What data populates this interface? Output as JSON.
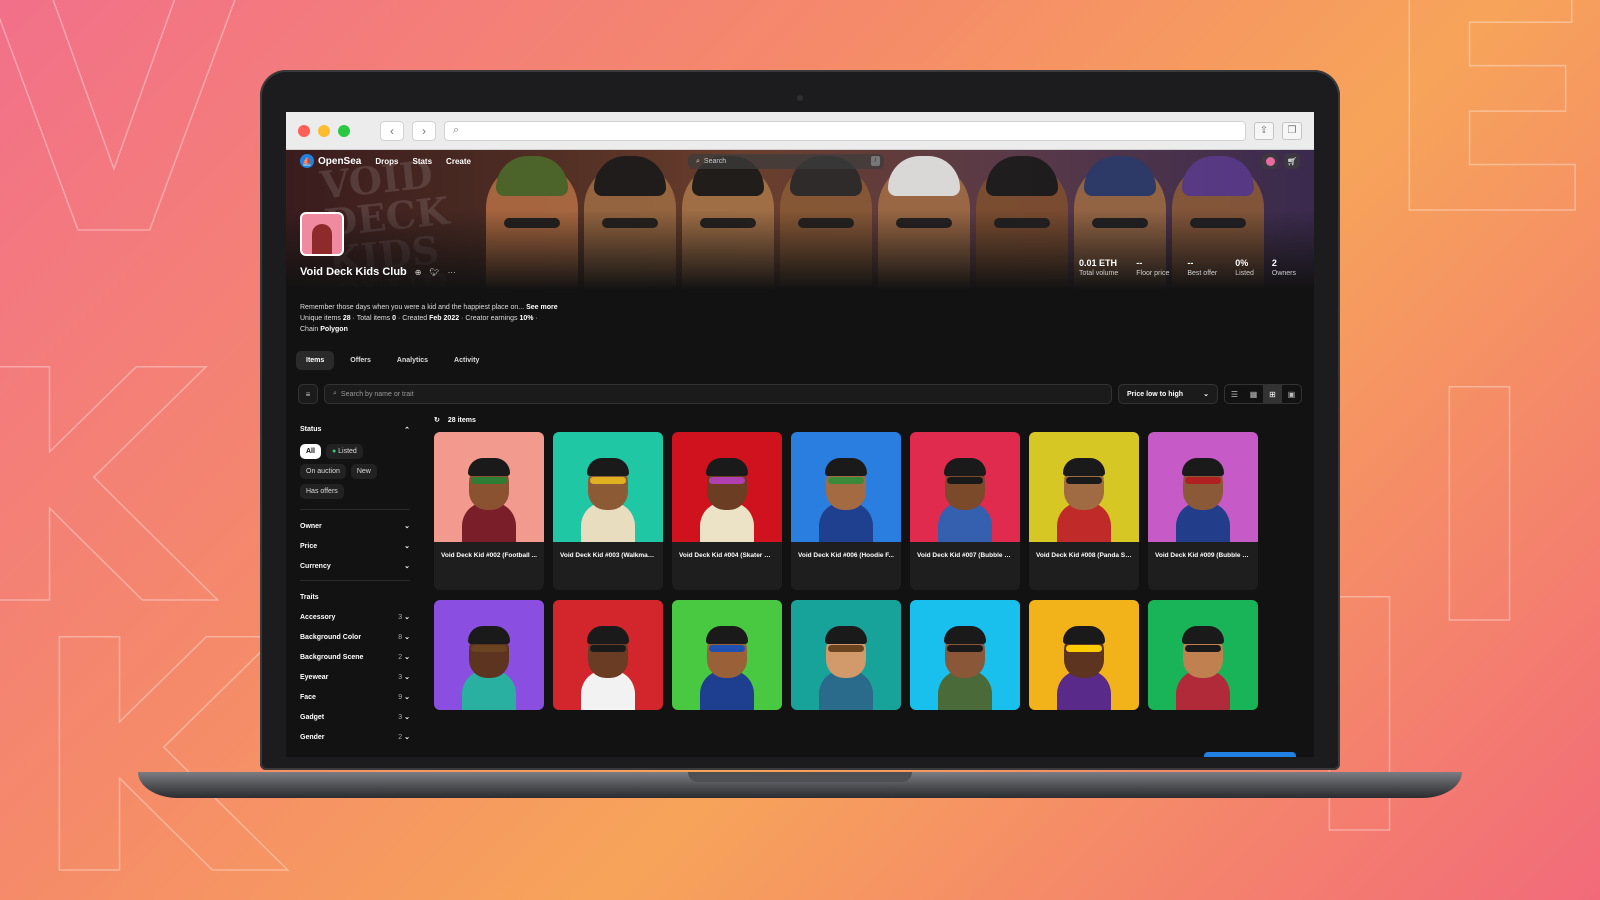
{
  "topnav": {
    "brand": "OpenSea",
    "links": [
      "Drops",
      "Stats",
      "Create"
    ],
    "search_placeholder": "Search",
    "search_shortcut": "/"
  },
  "collection": {
    "title": "Void Deck Kids Club",
    "banner_text": "VOID DECK KIDS CLUB",
    "stats": [
      {
        "value": "0.01 ETH",
        "label": "Total volume"
      },
      {
        "value": "--",
        "label": "Floor price"
      },
      {
        "value": "--",
        "label": "Best offer"
      },
      {
        "value": "0%",
        "label": "Listed"
      },
      {
        "value": "2",
        "label": "Owners"
      }
    ],
    "description": "Remember those days when you were a kid and the happiest place on...",
    "see_more": "See more",
    "meta": {
      "unique_items_label": "Unique items",
      "unique_items": "28",
      "total_items_label": "Total items",
      "total_items": "0",
      "created_label": "Created",
      "created": "Feb 2022",
      "earnings_label": "Creator earnings",
      "earnings": "10%",
      "chain_label": "Chain",
      "chain": "Polygon"
    }
  },
  "tabs": [
    "Items",
    "Offers",
    "Analytics",
    "Activity"
  ],
  "toolbar": {
    "search_placeholder": "Search by name or trait",
    "sort": "Price low to high"
  },
  "sidebar": {
    "status_label": "Status",
    "status_chips": [
      "All",
      "Listed",
      "On auction",
      "New",
      "Has offers"
    ],
    "filters": [
      "Owner",
      "Price",
      "Currency"
    ],
    "traits_label": "Traits",
    "traits": [
      {
        "name": "Accessory",
        "count": "3"
      },
      {
        "name": "Background Color",
        "count": "8"
      },
      {
        "name": "Background Scene",
        "count": "2"
      },
      {
        "name": "Eyewear",
        "count": "3"
      },
      {
        "name": "Face",
        "count": "9"
      },
      {
        "name": "Gadget",
        "count": "3"
      },
      {
        "name": "Gender",
        "count": "2"
      }
    ]
  },
  "results": {
    "count_text": "28 items"
  },
  "items_row1": [
    {
      "name": "Void Deck Kid #002 (Football ...",
      "bg": "#f39a8e",
      "shirt": "#7a1f2a",
      "skin": "#8a5230",
      "glass": "#2f7d35"
    },
    {
      "name": "Void Deck Kid #003 (Walkman ...",
      "bg": "#1fc7a5",
      "shirt": "#e9ddc0",
      "skin": "#8d5a36",
      "glass": "#e0b020"
    },
    {
      "name": "Void Deck Kid #004 (Skater Kid)",
      "bg": "#d0121e",
      "shirt": "#ece2c6",
      "skin": "#6b3d22",
      "glass": "#b040b0"
    },
    {
      "name": "Void Deck Kid #006 (Hoodie F...",
      "bg": "#2a7ee0",
      "shirt": "#1f3f8f",
      "skin": "#a46a42",
      "glass": "#3a8a3a"
    },
    {
      "name": "Void Deck Kid #007 (Bubble G...",
      "bg": "#e02a4e",
      "shirt": "#3560b0",
      "skin": "#7a4a2a",
      "glass": "#1a1a1a"
    },
    {
      "name": "Void Deck Kid #008 (Panda Sk...",
      "bg": "#d7c724",
      "shirt": "#c02a28",
      "skin": "#a06a42",
      "glass": "#1a1a1a"
    },
    {
      "name": "Void Deck Kid #009 (Bubble G...",
      "bg": "#c65ac6",
      "shirt": "#223e8a",
      "skin": "#8a5a38",
      "glass": "#b02020"
    }
  ],
  "items_row2": [
    {
      "name": "",
      "bg": "#8a4ee0",
      "shirt": "#2ab0a0",
      "skin": "#5c3420",
      "glass": "#6a4420"
    },
    {
      "name": "",
      "bg": "#d2262c",
      "shirt": "#f2f2f2",
      "skin": "#6a3c24",
      "glass": "#1a1a1a"
    },
    {
      "name": "",
      "bg": "#49c842",
      "shirt": "#1e3e90",
      "skin": "#9a6038",
      "glass": "#2050b0"
    },
    {
      "name": "",
      "bg": "#18a39a",
      "shirt": "#2a6a8a",
      "skin": "#d29a6a",
      "glass": "#6a4420"
    },
    {
      "name": "",
      "bg": "#19c0ee",
      "shirt": "#4a6a3a",
      "skin": "#8a5838",
      "glass": "#1a1a1a"
    },
    {
      "name": "",
      "bg": "#f2b21a",
      "shirt": "#5a2a8a",
      "skin": "#5c3420",
      "glass": "#ffcc00"
    },
    {
      "name": "",
      "bg": "#19b457",
      "shirt": "#b02a3a",
      "skin": "#c08050",
      "glass": "#1a1a1a"
    }
  ]
}
